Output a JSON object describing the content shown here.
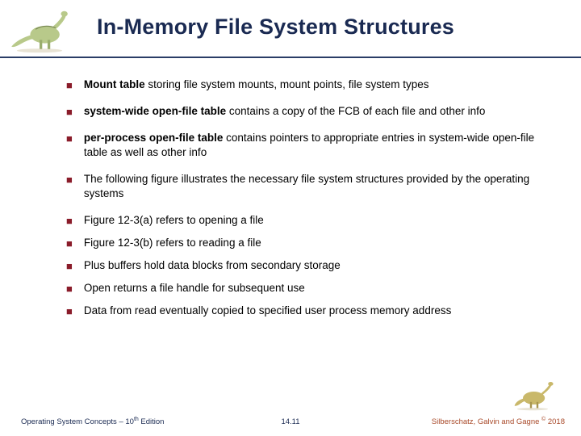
{
  "title": "In-Memory File System Structures",
  "bullets": [
    {
      "bold": "Mount table",
      "rest": " storing file system mounts, mount points, file system types"
    },
    {
      "bold": "system-wide open-file table",
      "rest": " contains a copy of the FCB of each file and other info"
    },
    {
      "bold": "per-process open-file table",
      "rest": " contains pointers to appropriate entries in system-wide open-file table as well as other info"
    },
    {
      "bold": "",
      "rest": "The following figure illustrates the necessary file system structures provided by the operating systems"
    },
    {
      "bold": "",
      "rest": "Figure 12-3(a) refers to opening a file"
    },
    {
      "bold": "",
      "rest": "Figure 12-3(b) refers to reading a file"
    },
    {
      "bold": "",
      "rest": "Plus buffers hold data blocks from secondary storage"
    },
    {
      "bold": "",
      "rest": "Open returns a file handle for subsequent use"
    },
    {
      "bold": "",
      "rest": "Data from read eventually copied to specified user process memory address"
    }
  ],
  "footer": {
    "left_a": "Operating System Concepts – 10",
    "left_sup": "th",
    "left_b": " Edition",
    "center": "14.11",
    "right_a": "Silberschatz, Galvin and Gagne ",
    "right_sup": "©",
    "right_b": " 2018"
  }
}
